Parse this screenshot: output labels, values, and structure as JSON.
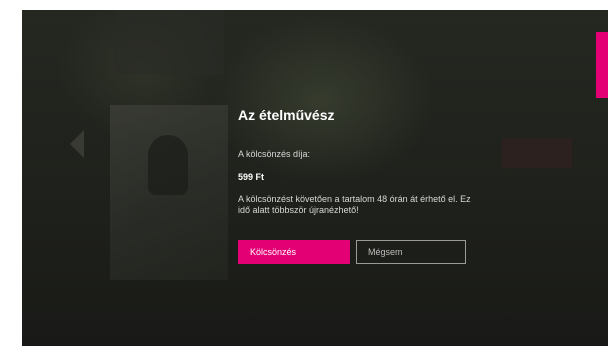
{
  "dialog": {
    "title": "Az ételművész",
    "fee_label": "A kölcsönzés díja:",
    "price": "599 Ft",
    "info": "A kölcsönzést követően a tartalom 48 órán át érhető el. Ez idő alatt többször újranézhető!",
    "rent_button": "Kölcsönzés",
    "cancel_button": "Mégsem"
  },
  "colors": {
    "accent": "#e20074",
    "overlay": "#1d1f1b"
  },
  "icons": {
    "left_arrow": "chevron-left-icon"
  }
}
